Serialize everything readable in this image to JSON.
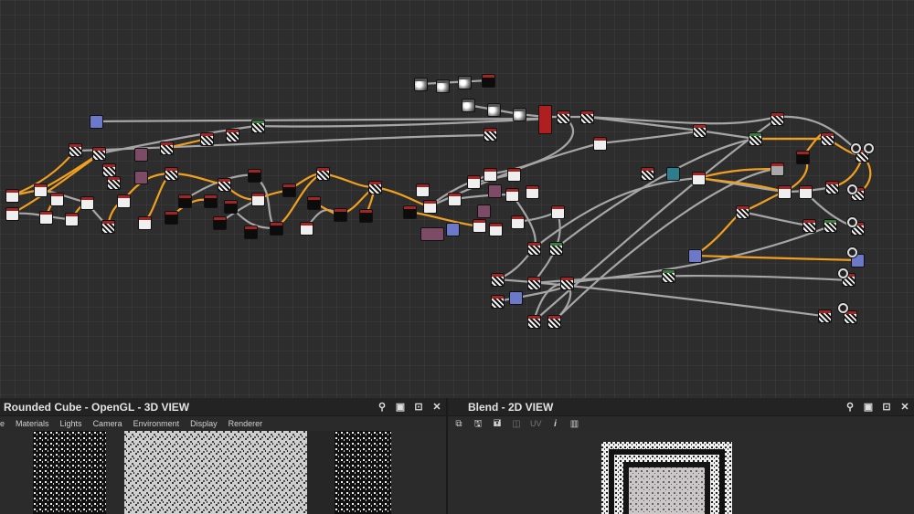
{
  "graph": {
    "node_colors": {
      "frame_top": "#a02525",
      "link_orange": "#f0a020",
      "link_gray": "#a0a0a0"
    }
  },
  "panel_3d": {
    "title": "Rounded Cube - OpenGL - 3D VIEW",
    "menu": [
      "e",
      "Materials",
      "Lights",
      "Camera",
      "Environment",
      "Display",
      "Renderer"
    ],
    "icons": [
      "pin-icon",
      "restore-icon",
      "maximize-icon",
      "close-icon"
    ]
  },
  "panel_2d": {
    "title": "Blend - 2D VIEW",
    "toolbar": [
      "copy-icon",
      "save-icon",
      "save-as-icon",
      "channel-icon",
      "uv-label",
      "info-icon",
      "histogram-icon"
    ],
    "uv_label": "UV",
    "icons": [
      "pin-icon",
      "restore-icon",
      "maximize-icon",
      "close-icon"
    ]
  },
  "window_glyphs": {
    "pin": "⚲",
    "restore": "▣",
    "maximize": "⊡",
    "close": "✕"
  },
  "toolbar_glyphs": {
    "copy": "⧉",
    "save": "🖫",
    "save_as": "🖬",
    "channel": "◫",
    "info": "i",
    "histogram": "▥"
  }
}
